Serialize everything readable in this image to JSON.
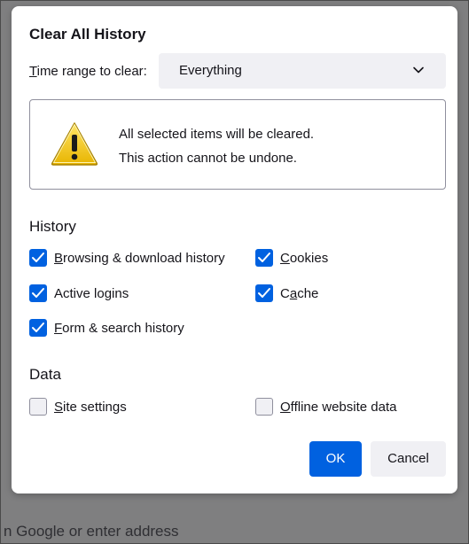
{
  "dialog": {
    "title": "Clear All History",
    "time_range": {
      "label_prefix": "",
      "label_accesskey": "T",
      "label_rest": "ime range to clear:",
      "selected": "Everything"
    },
    "warning": {
      "icon": "warning-icon",
      "line1": "All selected items will be cleared.",
      "line2": "This action cannot be undone."
    },
    "history": {
      "heading": "History",
      "items": [
        {
          "prefix": "",
          "accesskey": "B",
          "rest": "rowsing & download history",
          "checked": true
        },
        {
          "prefix": "",
          "accesskey": "C",
          "rest": "ookies",
          "checked": true
        },
        {
          "prefix": "",
          "accesskey": "",
          "rest": "Active logins",
          "checked": true
        },
        {
          "prefix": "C",
          "accesskey": "a",
          "rest": "che",
          "checked": true
        },
        {
          "prefix": "",
          "accesskey": "F",
          "rest": "orm & search history",
          "checked": true
        }
      ]
    },
    "data": {
      "heading": "Data",
      "items": [
        {
          "prefix": "",
          "accesskey": "S",
          "rest": "ite settings",
          "checked": false
        },
        {
          "prefix": "",
          "accesskey": "O",
          "rest": "ffline website data",
          "checked": false
        }
      ]
    },
    "buttons": {
      "ok": "OK",
      "cancel": "Cancel"
    }
  },
  "background": {
    "address_hint": "n Google or enter address"
  },
  "colors": {
    "accent": "#0061e0",
    "button_secondary": "#f0f0f4",
    "text": "#15141a",
    "warning_yellow": "#ffd21a"
  }
}
